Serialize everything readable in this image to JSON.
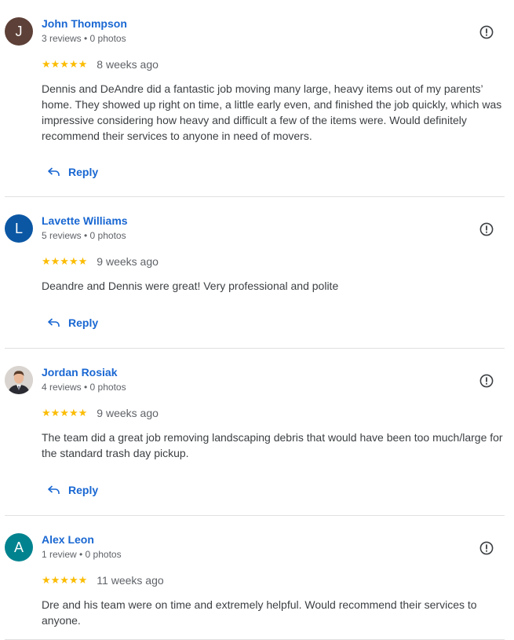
{
  "reviews": [
    {
      "avatar_letter": "J",
      "avatar_color": "#5d4037",
      "name": "John Thompson",
      "meta": "3 reviews • 0 photos",
      "stars": "★★★★★",
      "rating": 5,
      "age": "8 weeks ago",
      "text": "Dennis and DeAndre did a fantastic job moving many large, heavy items out of my parents’ home. They showed up right on time, a little early even, and finished the job quickly, which was impressive considering how heavy and difficult a few of the items were. Would definitely recommend their services to anyone in need of movers.",
      "reply_label": "Reply"
    },
    {
      "avatar_letter": "L",
      "avatar_color": "#0b57a4",
      "name": "Lavette Williams",
      "meta": "5 reviews • 0 photos",
      "stars": "★★★★★",
      "rating": 5,
      "age": "9 weeks ago",
      "text": "Deandre and Dennis were great! Very professional and polite",
      "reply_label": "Reply"
    },
    {
      "avatar_letter": "",
      "avatar_color": "#d9d4cf",
      "name": "Jordan Rosiak",
      "meta": "4 reviews • 0 photos",
      "stars": "★★★★★",
      "rating": 5,
      "age": "9 weeks ago",
      "text": "The team did a great job removing landscaping debris that would have been too much/large for the standard trash day pickup.",
      "reply_label": "Reply"
    },
    {
      "avatar_letter": "A",
      "avatar_color": "#00838f",
      "name": "Alex Leon",
      "meta": "1 review • 0 photos",
      "stars": "★★★★★",
      "rating": 5,
      "age": "11 weeks ago",
      "text": "Dre and his team were on time and extremely helpful. Would recommend their services to anyone.",
      "reply_label": "Reply"
    }
  ],
  "colors": {
    "link": "#1967d2",
    "star": "#fbbc04"
  }
}
